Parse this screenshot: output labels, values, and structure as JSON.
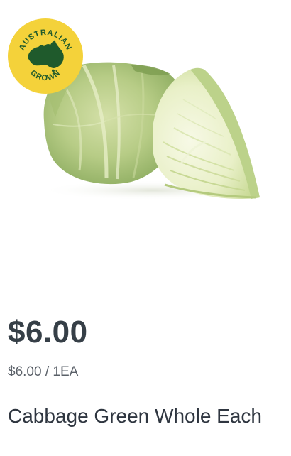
{
  "product": {
    "badge": {
      "top_text": "AUSTRALIAN",
      "bottom_text": "GROWN",
      "icon": "australia-map-icon",
      "color": "#f4d23a",
      "ink_color": "#1f5a2c"
    },
    "image": {
      "subject": "cabbage-image"
    },
    "price": "$6.00",
    "unit_price": "$6.00 / 1EA",
    "name": "Cabbage Green Whole Each"
  }
}
